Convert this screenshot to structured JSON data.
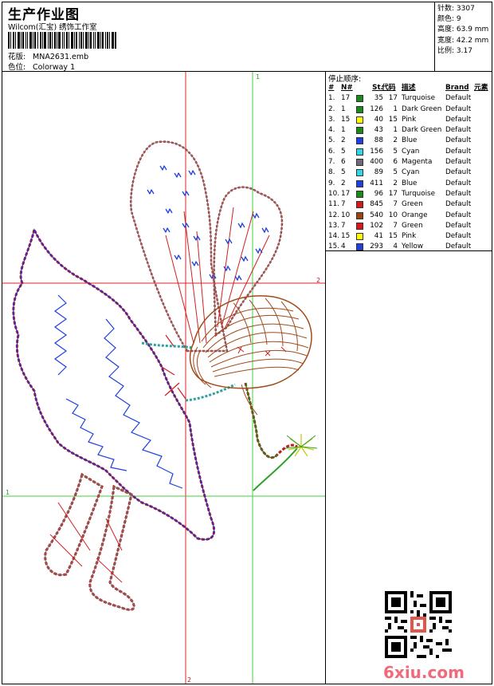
{
  "header": {
    "title": "生产作业图",
    "subtitle": "Wilcom(汇宝) 绣饰工作室",
    "design_label": "花版:",
    "design_value": "MNA2631.emb",
    "colorway_label": "色位:",
    "colorway_value": "Colorway 1"
  },
  "stats": {
    "stitches": "针数: 3307",
    "colors": "颜色: 9",
    "height": "高度: 63.9 mm",
    "width": "宽度: 42.2 mm",
    "scale": "比例: 3.17"
  },
  "stop_sequence": {
    "title": "停止顺序:",
    "columns": {
      "idx": "#",
      "n": "N#",
      "st": "St.",
      "code": "代码",
      "desc": "描述",
      "brand": "Brand",
      "element": "元素"
    },
    "rows": [
      {
        "idx": "1.",
        "n": "17",
        "color": "#1a8a1a",
        "st": "35",
        "code": "17",
        "desc": "Turquoise",
        "brand": "Default"
      },
      {
        "idx": "2.",
        "n": "1",
        "color": "#1a8a1a",
        "st": "126",
        "code": "1",
        "desc": "Dark Green",
        "brand": "Default"
      },
      {
        "idx": "3.",
        "n": "15",
        "color": "#ffff00",
        "st": "40",
        "code": "15",
        "desc": "Pink",
        "brand": "Default"
      },
      {
        "idx": "4.",
        "n": "1",
        "color": "#1a8a1a",
        "st": "43",
        "code": "1",
        "desc": "Dark Green",
        "brand": "Default"
      },
      {
        "idx": "5.",
        "n": "2",
        "color": "#1f3fe0",
        "st": "88",
        "code": "2",
        "desc": "Blue",
        "brand": "Default"
      },
      {
        "idx": "6.",
        "n": "5",
        "color": "#2fd6e6",
        "st": "156",
        "code": "5",
        "desc": "Cyan",
        "brand": "Default"
      },
      {
        "idx": "7.",
        "n": "6",
        "color": "#6b6b78",
        "st": "400",
        "code": "6",
        "desc": "Magenta",
        "brand": "Default"
      },
      {
        "idx": "8.",
        "n": "5",
        "color": "#2fd6e6",
        "st": "89",
        "code": "5",
        "desc": "Cyan",
        "brand": "Default"
      },
      {
        "idx": "9.",
        "n": "2",
        "color": "#1f3fe0",
        "st": "411",
        "code": "2",
        "desc": "Blue",
        "brand": "Default"
      },
      {
        "idx": "10.",
        "n": "17",
        "color": "#1a8a1a",
        "st": "96",
        "code": "17",
        "desc": "Turquoise",
        "brand": "Default"
      },
      {
        "idx": "11.",
        "n": "7",
        "color": "#d81818",
        "st": "845",
        "code": "7",
        "desc": "Green",
        "brand": "Default"
      },
      {
        "idx": "12.",
        "n": "10",
        "color": "#9a4410",
        "st": "540",
        "code": "10",
        "desc": "Orange",
        "brand": "Default"
      },
      {
        "idx": "13.",
        "n": "7",
        "color": "#d81818",
        "st": "102",
        "code": "7",
        "desc": "Green",
        "brand": "Default"
      },
      {
        "idx": "14.",
        "n": "15",
        "color": "#ffff00",
        "st": "41",
        "code": "15",
        "desc": "Pink",
        "brand": "Default"
      },
      {
        "idx": "15.",
        "n": "4",
        "color": "#1f3fe0",
        "st": "293",
        "code": "4",
        "desc": "Yellow",
        "brand": "Default"
      }
    ]
  },
  "guides": {
    "top_marker": "1",
    "right_marker": "2",
    "left_marker": "1",
    "bottom_marker": "2"
  },
  "watermark": {
    "text": "6xiu.com"
  },
  "colors": {
    "guide_red": "#e02020",
    "guide_green": "#40d040",
    "brand_pink": "#f06a7c"
  }
}
